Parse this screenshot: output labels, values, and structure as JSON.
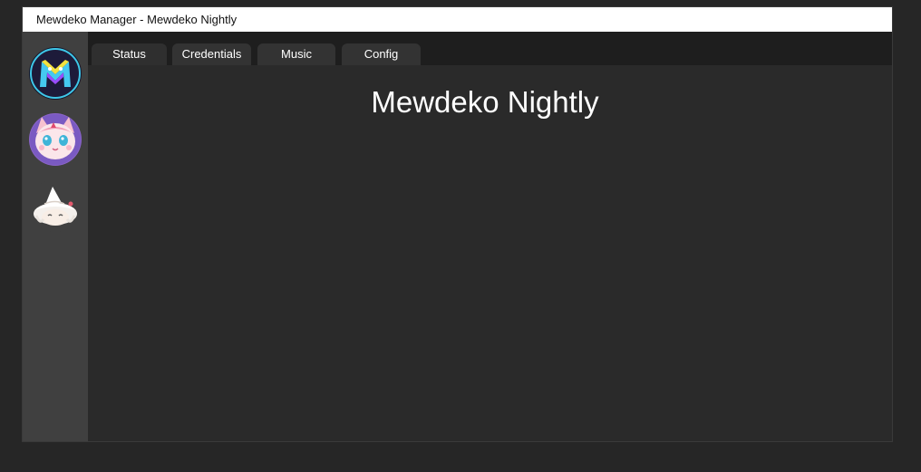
{
  "window": {
    "title": "Mewdeko Manager  -  Mewdeko Nightly"
  },
  "sidebar": {
    "bots": [
      {
        "icon": "mewdeko-logo-avatar-icon"
      },
      {
        "icon": "pink-cat-girl-avatar-icon"
      },
      {
        "icon": "white-hat-chibi-avatar-icon"
      }
    ]
  },
  "tabs": [
    {
      "label": "Status"
    },
    {
      "label": "Credentials"
    },
    {
      "label": "Music"
    },
    {
      "label": "Config"
    }
  ],
  "active_tab": "Status",
  "status": {
    "bot_name": "Mewdeko Nightly"
  },
  "colors": {
    "background": "#262626",
    "sidebar": "#404040",
    "tabbar": "#1e1e1e",
    "tab": "#333333",
    "content": "#2a2a2a",
    "text": "#ffffff"
  }
}
